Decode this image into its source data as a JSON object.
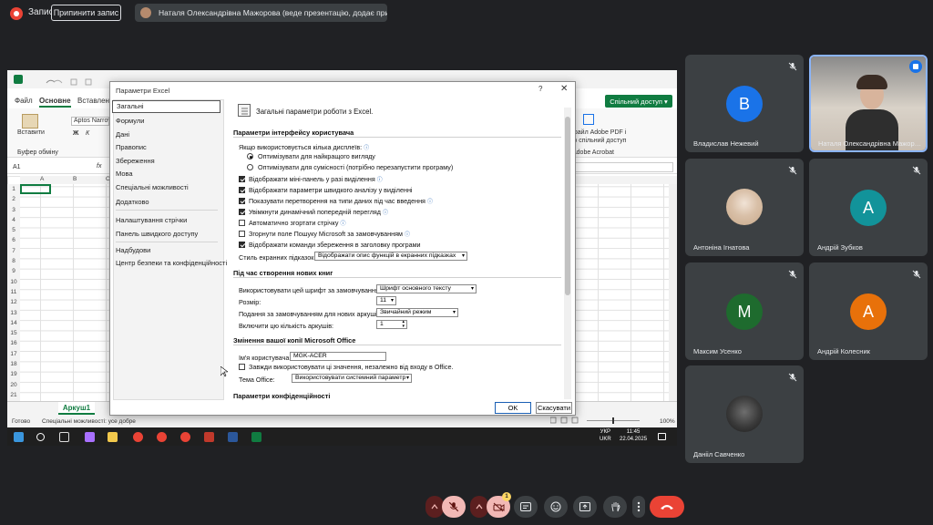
{
  "top_bar": {
    "record_label": "Запис",
    "stop_recording_label": "Припинити запис",
    "presenter_text": "Наталя Олександрівна Мажорова (веде презентацію, додає примітки)"
  },
  "excel": {
    "menu": {
      "file": "Файл",
      "home": "Основне",
      "insert": "Вставлення"
    },
    "share_label": "Спільний доступ",
    "paste_label": "Вставити",
    "clipboard_label": "Буфер обміну",
    "font_name": "Aptos Narrow",
    "acrobat_text_1": "файл Adobe PDF і",
    "acrobat_text_2": "ю спільний доступ",
    "acrobat_group": "Adobe Acrobat",
    "name_box": "A1",
    "fx": "fx",
    "columns": [
      "A",
      "B",
      "C"
    ],
    "rows": [
      "1",
      "2",
      "3",
      "4",
      "5",
      "6",
      "7",
      "8",
      "9",
      "10",
      "11",
      "12",
      "13",
      "14",
      "15",
      "16",
      "17",
      "18",
      "19",
      "20",
      "21",
      "22"
    ],
    "sheet_tab": "Аркуш1",
    "status_ready": "Готово",
    "status_accessibility": "Спеціальні можливості: усе добре",
    "zoom": "100%",
    "taskbar": {
      "lang_1": "УКР",
      "lang_2": "UKR",
      "time": "11:45",
      "date": "22.04.2025"
    }
  },
  "dialog": {
    "title": "Параметри Excel",
    "help": "?",
    "close": "✕",
    "nav": [
      "Загальні",
      "Формули",
      "Дані",
      "Правопис",
      "Збереження",
      "Мова",
      "Спеціальні можливості",
      "Додатково",
      "Налаштування стрічки",
      "Панель швидкого доступу",
      "Надбудови",
      "Центр безпеки та конфіденційності"
    ],
    "heading": "Загальні параметри роботи з Excel.",
    "ui_section": "Параметри інтерфейсу користувача",
    "multi_display": "Якщо використовується кілька дисплеїв:",
    "radio_best": "Оптимізувати для найкращого вигляду",
    "radio_compat": "Оптимізувати для сумісності (потрібно перезапустити програму)",
    "checks": [
      {
        "label": "Відображати міні-панель у разі виділення",
        "checked": true
      },
      {
        "label": "Відображати параметри швидкого аналізу у виділенні",
        "checked": true
      },
      {
        "label": "Показувати перетворення на типи даних під час введення",
        "checked": true
      },
      {
        "label": "Увімкнути динамічний попередній перегляд",
        "checked": true
      },
      {
        "label": "Автоматично згортати стрічку",
        "checked": false
      },
      {
        "label": "Згорнути поле Пошуку Microsoft за замовчуванням",
        "checked": false
      },
      {
        "label": "Відображати команди збереження в заголовку програми",
        "checked": true
      }
    ],
    "tooltip_style_label": "Стиль екранних підказок:",
    "tooltip_style_value": "Відображати опис функцій в екранних підказках",
    "new_books_section": "Під час створення нових книг",
    "font_label": "Використовувати цей шрифт за замовчуванням:",
    "font_value": "Шрифт основного тексту",
    "size_label": "Розмір:",
    "size_value": "11",
    "view_label": "Подання за замовчуванням для нових аркушів:",
    "view_value": "Звичайний режим",
    "sheets_label": "Включити цю кількість аркушів:",
    "sheets_value": "1",
    "personalize_section": "Змінення вашої копії Microsoft Office",
    "username_label": "Ім'я користувача:",
    "username_value": "MGK-ACER",
    "always_use_label": "Завжди використовувати ці значення, незалежно від входу в Office.",
    "theme_label": "Тема Office:",
    "theme_value": "Використовувати системний параметр",
    "privacy_section": "Параметри конфіденційності",
    "ok": "OK",
    "cancel": "Скасувати"
  },
  "participants": [
    {
      "name": "Владислав Нежевий",
      "initial": "В",
      "color": "#1a73e8"
    },
    {
      "name": "Наталя Олександрівна Мажорова",
      "initial": "",
      "color": "#5f6368"
    },
    {
      "name": "Антоніна Ігнатова",
      "initial": "",
      "color": "#5f6368"
    },
    {
      "name": "Андрій Зубков",
      "initial": "А",
      "color": "#12939a"
    },
    {
      "name": "Максим Усенко",
      "initial": "М",
      "color": "#1e6b2e"
    },
    {
      "name": "Андрій Колесник",
      "initial": "А",
      "color": "#e8710a"
    },
    {
      "name": "Данііл Савченко",
      "initial": "",
      "color": "#5f6368"
    }
  ],
  "controls": {
    "notification_count": "1"
  }
}
